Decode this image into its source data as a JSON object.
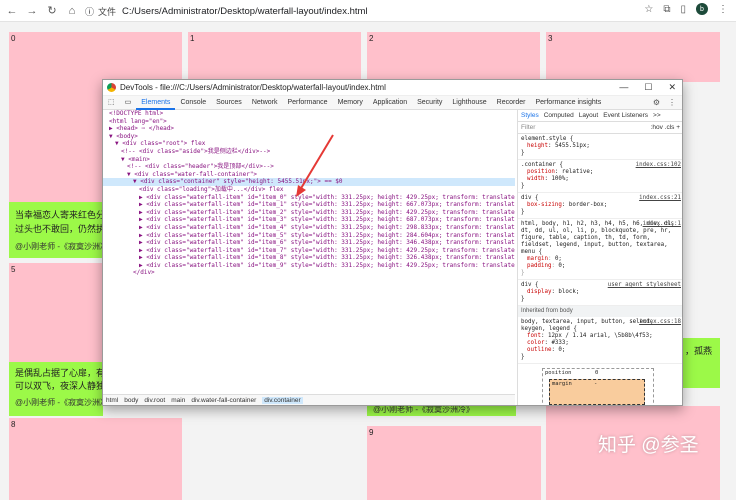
{
  "browser": {
    "file_tag": "文件",
    "address": "C:/Users/Administrator/Desktop/waterfall-layout/index.html",
    "avatar_letter": "b"
  },
  "page": {
    "cards": [
      {
        "num": "0"
      },
      {
        "num": "1"
      },
      {
        "num": "2"
      },
      {
        "num": "3"
      },
      {
        "num": "5"
      },
      {
        "num": "8"
      },
      {
        "num": "9"
      }
    ],
    "green1": {
      "line1": "当幸福恋人寄来红色分享",
      "line2": "过头也不敢回，仍然执拗",
      "author": "@小刚老师 -《寂寞沙洲冷》"
    },
    "green2": {
      "line1": "是偶乱占据了心扉，有花",
      "line2": "可以双飞，夜深人静独徘",
      "author": "@小刚老师 -《寂寞沙洲冷》"
    },
    "green3": {
      "line1": "，孤燕",
      "author": "@小刚老师 -《寂寞沙洲冷》"
    },
    "watermark": "知乎 @参圣"
  },
  "devtools": {
    "title": "DevTools - file:///C:/Users/Administrator/Desktop/waterfall-layout/index.html",
    "tabs": [
      "Elements",
      "Console",
      "Sources",
      "Network",
      "Performance",
      "Memory",
      "Application",
      "Security",
      "Lighthouse",
      "Recorder",
      "Performance insights"
    ],
    "dom_lines": [
      {
        "indent": 1,
        "html": "<!DOCTYPE html>"
      },
      {
        "indent": 1,
        "html": "<html lang=\"en\">"
      },
      {
        "indent": 1,
        "html": "▶ <head> ⋯ </head>"
      },
      {
        "indent": 1,
        "html": "▼ <body>"
      },
      {
        "indent": 2,
        "html": "▼ <div class=\"root\"> flex"
      },
      {
        "indent": 3,
        "html": "<!-- <div class=\"aside\">我是侧边栏</div>-->"
      },
      {
        "indent": 3,
        "html": "▼ <main>"
      },
      {
        "indent": 4,
        "html": "<!-- <div class=\"header\">我是顶部</div>-->"
      },
      {
        "indent": 4,
        "html": "▼ <div class=\"water-fall-container\">"
      },
      {
        "indent": 5,
        "html": "▼ <div class=\"container\" style=\"height: 5455.51px;\"> == $0",
        "selected": true
      },
      {
        "indent": 6,
        "html": "<div class=\"loading\">加载中...</div> flex"
      },
      {
        "indent": 6,
        "html": "▶ <div class=\"waterfall-item\" id=\"item_0\" style=\"width: 331.25px; height: 429.25px; transform: translate(0px, 0px);\"> ⋯ </div> flex"
      },
      {
        "indent": 6,
        "html": "▶ <div class=\"waterfall-item\" id=\"item_1\" style=\"width: 331.25px; height: 667.073px; transform: translate(347.25px, 0px);\"> ⋯ </div> flex"
      },
      {
        "indent": 6,
        "html": "▶ <div class=\"waterfall-item\" id=\"item_2\" style=\"width: 331.25px; height: 429.25px; transform: translate(694.5px, 0px);\"> ⋯ </div> flex"
      },
      {
        "indent": 6,
        "html": "▶ <div class=\"waterfall-item\" id=\"item_3\" style=\"width: 331.25px; height: 687.073px; transform: translate(1041.75px, 0px);\"> ⋯ </div> flex"
      },
      {
        "indent": 6,
        "html": "▶ <div class=\"waterfall-item\" id=\"item_4\" style=\"width: 331.25px; height: 298.833px; transform: translate(694.5px, 445.25px);\"> ⋯ </div> flex"
      },
      {
        "indent": 6,
        "html": "▶ <div class=\"waterfall-item\" id=\"item_5\" style=\"width: 331.25px; height: 284.604px; transform: translate(0px, 445.25px);\"> ⋯ </div> flex"
      },
      {
        "indent": 6,
        "html": "▶ <div class=\"waterfall-item\" id=\"item_6\" style=\"width: 331.25px; height: 346.438px; transform: translate(347.25px, 683.073px);\"> ⋯ </div> flex"
      },
      {
        "indent": 6,
        "html": "▶ <div class=\"waterfall-item\" id=\"item_7\" style=\"width: 331.25px; height: 429.25px; transform: translate(1041.75px, 703.073px);\"> ⋯ </div> flex"
      },
      {
        "indent": 6,
        "html": "▶ <div class=\"waterfall-item\" id=\"item_8\" style=\"width: 331.25px; height: 326.438px; transform: translate(0px, 745.854px);\"> ⋯ </div> flex"
      },
      {
        "indent": 6,
        "html": "▶ <div class=\"waterfall-item\" id=\"item_9\" style=\"width: 331.25px; height: 429.25px; transform: translate(694.5px, 760.083px);\"> ⋯ </div> flex"
      },
      {
        "indent": 5,
        "html": "</div>"
      }
    ],
    "breadcrumb": [
      "html",
      "body",
      "div.root",
      "main",
      "div.water-fall-container",
      "div.container"
    ],
    "styles": {
      "tabs": [
        "Styles",
        "Computed",
        "Layout",
        "Event Listeners",
        ">>"
      ],
      "filter_placeholder": "Filter",
      "filter_controls": ":hov  .cls  +",
      "rules": [
        {
          "selector": "element.style {",
          "src": "",
          "props": [
            [
              "height",
              "5455.51px;"
            ]
          ]
        },
        {
          "selector": ".container {",
          "src": "index.css:102",
          "props": [
            [
              "position",
              "relative;"
            ],
            [
              "width",
              "100%;"
            ]
          ]
        },
        {
          "selector": "div {",
          "src": "index.css:21",
          "props": [
            [
              "box-sizing",
              "border-box;"
            ]
          ]
        },
        {
          "selector": "html, body, h1, h2, h3, h4, h5, h6, div, dl, dt, dd, ul, ol, li, p, blockquote, pre, hr, figure, table, caption, th, td, form, fieldset, legend, input, button, textarea, menu {",
          "src": "index.css:1",
          "props": [
            [
              "margin",
              "0;"
            ],
            [
              "padding",
              "0;"
            ]
          ],
          "faded": true
        },
        {
          "selector": "div {",
          "src": "user agent stylesheet",
          "props": [
            [
              "display",
              "block;"
            ]
          ]
        }
      ],
      "inherited_label": "Inherited from body",
      "body_rule": {
        "selector": "body, textarea, input, button, select, keygen, legend {",
        "src": "index.css:18",
        "props": [
          [
            "font",
            "12px / 1.14 arial, \\5b8b\\4f53;"
          ],
          [
            "color",
            "#333;"
          ],
          [
            "outline",
            "0;"
          ]
        ]
      },
      "box_position_label": "position",
      "box_position_value": "0",
      "box_margin_label": "margin",
      "box_margin_value": "-"
    }
  }
}
